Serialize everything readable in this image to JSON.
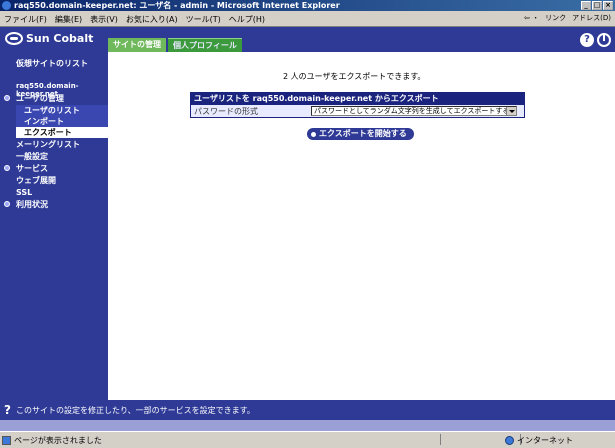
{
  "window": {
    "title": "raq550.domain-keeper.net: ユーザ名 - admin - Microsoft Internet Explorer"
  },
  "menu": {
    "items": [
      "ファイル(F)",
      "編集(E)",
      "表示(V)",
      "お気に入り(A)",
      "ツール(T)",
      "ヘルプ(H)"
    ],
    "back": "⇦ ・",
    "links": "リンク",
    "address": "アドレス(D)"
  },
  "brand": {
    "logo": "Sun Cobalt",
    "tabs": [
      "サイトの管理",
      "個人プロフィール"
    ]
  },
  "sidebar": {
    "virtual_sites": "仮想サイトのリスト",
    "site_name": "raq550.domain-keeper.net",
    "items": [
      {
        "label": "ユーザの管理",
        "level": "top",
        "bullet": true
      },
      {
        "label": "ユーザのリスト",
        "level": "sub"
      },
      {
        "label": "インポート",
        "level": "sub"
      },
      {
        "label": "エクスポート",
        "level": "sub",
        "selected": true
      },
      {
        "label": "メーリングリスト",
        "level": "top"
      },
      {
        "label": "一般設定",
        "level": "top"
      },
      {
        "label": "サービス",
        "level": "top",
        "bullet": true
      },
      {
        "label": "ウェブ展開",
        "level": "top"
      },
      {
        "label": "SSL",
        "level": "top"
      },
      {
        "label": "利用状況",
        "level": "top",
        "bullet": true
      }
    ]
  },
  "main": {
    "count_text": "2 人のユーザをエクスポートできます。",
    "panel_title": "ユーザリストを raq550.domain-keeper.net からエクスポート",
    "password_label": "パスワードの形式",
    "password_value": "パスワードとしてランダム文字列を生成してエクスポートする",
    "start_button": "エクスポートを開始する"
  },
  "info": {
    "text": "このサイトの設定を修正したり、一部のサービスを設定できます。"
  },
  "status": {
    "left": "ページが表示されました",
    "zone": "インターネット"
  },
  "colors": {
    "brand_blue": "#2e3a96",
    "panel_blue": "#1a237e",
    "tab_green": "#6fb85c"
  }
}
